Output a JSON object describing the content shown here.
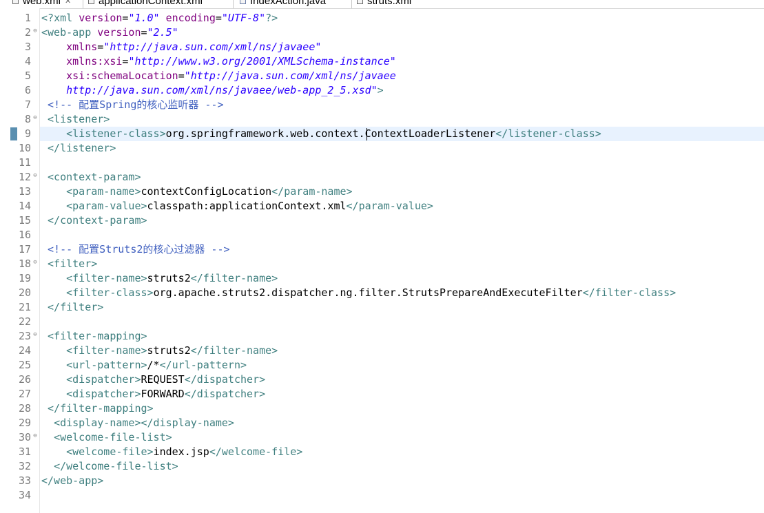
{
  "tabs": [
    {
      "label": "web.xml",
      "icon": "xml-file-icon",
      "active": true,
      "close": "✕"
    },
    {
      "label": "applicationContext.xml",
      "icon": "xml-file-icon",
      "active": false
    },
    {
      "label": "IndexAction.java",
      "icon": "java-file-icon",
      "active": false
    },
    {
      "label": "struts.xml",
      "icon": "xml-file-icon",
      "active": false
    }
  ],
  "editor": {
    "current_line": 9,
    "fold_markers": [
      2,
      8,
      12,
      18,
      23,
      30
    ],
    "change_markers": [
      9
    ],
    "lines": [
      {
        "n": "1",
        "segs": [
          [
            "d",
            "<?"
          ],
          [
            "d",
            "xml "
          ],
          [
            "a",
            "version"
          ],
          [
            "t",
            "="
          ],
          [
            "v",
            "\"1.0\""
          ],
          [
            "t",
            " "
          ],
          [
            "a",
            "encoding"
          ],
          [
            "t",
            "="
          ],
          [
            "v",
            "\"UTF-8\""
          ],
          [
            "d",
            "?>"
          ]
        ]
      },
      {
        "n": "2",
        "segs": [
          [
            "d",
            "<web-app "
          ],
          [
            "a",
            "version"
          ],
          [
            "t",
            "="
          ],
          [
            "v",
            "\"2.5\""
          ]
        ]
      },
      {
        "n": "3",
        "segs": [
          [
            "t",
            "    "
          ],
          [
            "a",
            "xmlns"
          ],
          [
            "t",
            "="
          ],
          [
            "v",
            "\"http://java.sun.com/xml/ns/javaee\""
          ]
        ]
      },
      {
        "n": "4",
        "segs": [
          [
            "t",
            "    "
          ],
          [
            "a",
            "xmlns:xsi"
          ],
          [
            "t",
            "="
          ],
          [
            "v",
            "\"http://www.w3.org/2001/XMLSchema-instance\""
          ]
        ]
      },
      {
        "n": "5",
        "segs": [
          [
            "t",
            "    "
          ],
          [
            "a",
            "xsi:schemaLocation"
          ],
          [
            "t",
            "="
          ],
          [
            "v",
            "\"http://java.sun.com/xml/ns/javaee"
          ]
        ]
      },
      {
        "n": "6",
        "segs": [
          [
            "t",
            "    "
          ],
          [
            "v",
            "http://java.sun.com/xml/ns/javaee/web-app_2_5.xsd\""
          ],
          [
            "d",
            ">"
          ]
        ]
      },
      {
        "n": "7",
        "segs": [
          [
            "t",
            " "
          ],
          [
            "c",
            "<!-- 配置Spring的核心监听器 -->"
          ]
        ]
      },
      {
        "n": "8",
        "segs": [
          [
            "t",
            " "
          ],
          [
            "d",
            "<listener>"
          ]
        ]
      },
      {
        "n": "9",
        "segs": [
          [
            "t",
            "    "
          ],
          [
            "d",
            "<listener-class>"
          ],
          [
            "t",
            "org.springframework.web.context.ContextLoaderListener"
          ],
          [
            "d",
            "</listener-class>"
          ]
        ]
      },
      {
        "n": "10",
        "segs": [
          [
            "t",
            " "
          ],
          [
            "d",
            "</listener>"
          ]
        ]
      },
      {
        "n": "11",
        "segs": []
      },
      {
        "n": "12",
        "segs": [
          [
            "t",
            " "
          ],
          [
            "d",
            "<context-param>"
          ]
        ]
      },
      {
        "n": "13",
        "segs": [
          [
            "t",
            "    "
          ],
          [
            "d",
            "<param-name>"
          ],
          [
            "t",
            "contextConfigLocation"
          ],
          [
            "d",
            "</param-name>"
          ]
        ]
      },
      {
        "n": "14",
        "segs": [
          [
            "t",
            "    "
          ],
          [
            "d",
            "<param-value>"
          ],
          [
            "t",
            "classpath:applicationContext.xml"
          ],
          [
            "d",
            "</param-value>"
          ]
        ]
      },
      {
        "n": "15",
        "segs": [
          [
            "t",
            " "
          ],
          [
            "d",
            "</context-param>"
          ]
        ]
      },
      {
        "n": "16",
        "segs": []
      },
      {
        "n": "17",
        "segs": [
          [
            "t",
            " "
          ],
          [
            "c",
            "<!-- 配置Struts2的核心过滤器 -->"
          ]
        ]
      },
      {
        "n": "18",
        "segs": [
          [
            "t",
            " "
          ],
          [
            "d",
            "<filter>"
          ]
        ]
      },
      {
        "n": "19",
        "segs": [
          [
            "t",
            "    "
          ],
          [
            "d",
            "<filter-name>"
          ],
          [
            "t",
            "struts2"
          ],
          [
            "d",
            "</filter-name>"
          ]
        ]
      },
      {
        "n": "20",
        "segs": [
          [
            "t",
            "    "
          ],
          [
            "d",
            "<filter-class>"
          ],
          [
            "t",
            "org.apache.struts2.dispatcher.ng.filter.StrutsPrepareAndExecuteFilter"
          ],
          [
            "d",
            "</filter-class>"
          ]
        ]
      },
      {
        "n": "21",
        "segs": [
          [
            "t",
            " "
          ],
          [
            "d",
            "</filter>"
          ]
        ]
      },
      {
        "n": "22",
        "segs": []
      },
      {
        "n": "23",
        "segs": [
          [
            "t",
            " "
          ],
          [
            "d",
            "<filter-mapping>"
          ]
        ]
      },
      {
        "n": "24",
        "segs": [
          [
            "t",
            "    "
          ],
          [
            "d",
            "<filter-name>"
          ],
          [
            "t",
            "struts2"
          ],
          [
            "d",
            "</filter-name>"
          ]
        ]
      },
      {
        "n": "25",
        "segs": [
          [
            "t",
            "    "
          ],
          [
            "d",
            "<url-pattern>"
          ],
          [
            "t",
            "/*"
          ],
          [
            "d",
            "</url-pattern>"
          ]
        ]
      },
      {
        "n": "26",
        "segs": [
          [
            "t",
            "    "
          ],
          [
            "d",
            "<dispatcher>"
          ],
          [
            "t",
            "REQUEST"
          ],
          [
            "d",
            "</dispatcher>"
          ]
        ]
      },
      {
        "n": "27",
        "segs": [
          [
            "t",
            "    "
          ],
          [
            "d",
            "<dispatcher>"
          ],
          [
            "t",
            "FORWARD"
          ],
          [
            "d",
            "</dispatcher>"
          ]
        ]
      },
      {
        "n": "28",
        "segs": [
          [
            "t",
            " "
          ],
          [
            "d",
            "</filter-mapping>"
          ]
        ]
      },
      {
        "n": "29",
        "segs": [
          [
            "t",
            "  "
          ],
          [
            "d",
            "<display-name></display-name>"
          ]
        ]
      },
      {
        "n": "30",
        "segs": [
          [
            "t",
            "  "
          ],
          [
            "d",
            "<welcome-file-list>"
          ]
        ]
      },
      {
        "n": "31",
        "segs": [
          [
            "t",
            "    "
          ],
          [
            "d",
            "<welcome-file>"
          ],
          [
            "t",
            "index.jsp"
          ],
          [
            "d",
            "</welcome-file>"
          ]
        ]
      },
      {
        "n": "32",
        "segs": [
          [
            "t",
            "  "
          ],
          [
            "d",
            "</welcome-file-list>"
          ]
        ]
      },
      {
        "n": "33",
        "segs": [
          [
            "d",
            "</web-app>"
          ]
        ]
      },
      {
        "n": "34",
        "segs": []
      }
    ]
  }
}
